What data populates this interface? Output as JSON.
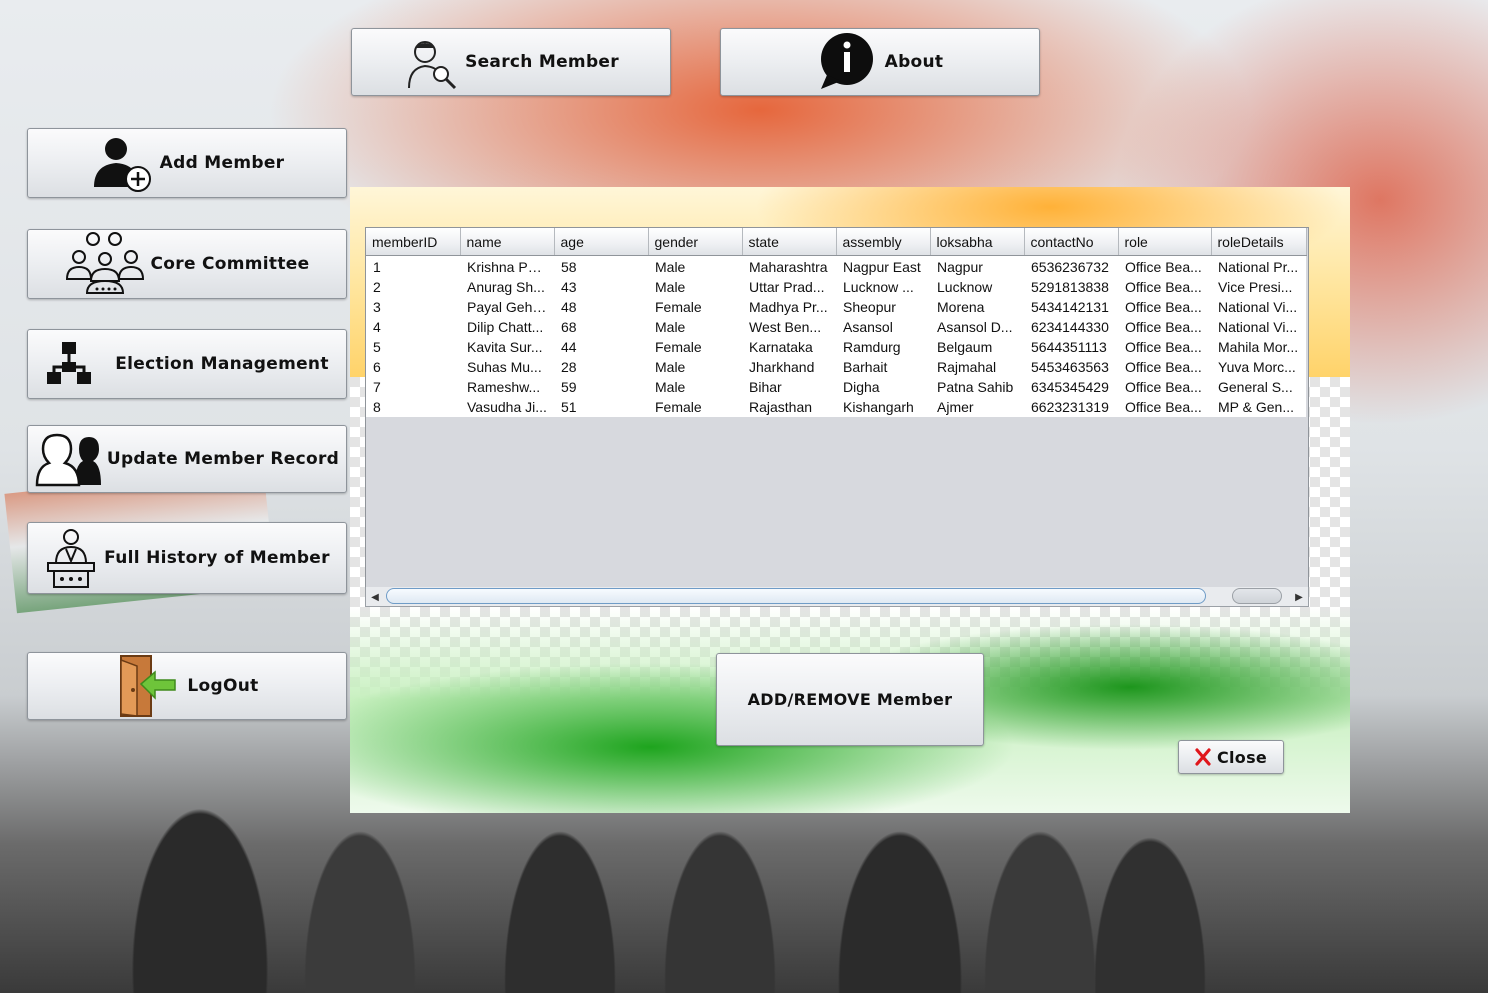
{
  "top_buttons": {
    "search": {
      "label": "Search Member",
      "icon": "search-member-icon"
    },
    "about": {
      "label": "About",
      "icon": "info-icon"
    }
  },
  "sidebar": {
    "items": [
      {
        "label": "Add Member",
        "icon": "add-member-icon"
      },
      {
        "label": "Core Committee",
        "icon": "committee-icon"
      },
      {
        "label": "Election Management",
        "icon": "hierarchy-icon"
      },
      {
        "label": "Update Member Record",
        "icon": "users-icon"
      },
      {
        "label": "Full History of Member",
        "icon": "speaker-podium-icon"
      },
      {
        "label": "LogOut",
        "icon": "logout-door-icon"
      }
    ]
  },
  "table": {
    "columns": [
      "memberID",
      "name",
      "age",
      "gender",
      "state",
      "assembly",
      "loksabha",
      "contactNo",
      "role",
      "roleDetails"
    ],
    "rows": [
      [
        "1",
        "Krishna Pa...",
        "58",
        "Male",
        "Maharashtra",
        "Nagpur East",
        "Nagpur",
        "6536236732",
        "Office Bea...",
        "National Pr..."
      ],
      [
        "2",
        "Anurag Sh...",
        "43",
        "Male",
        "Uttar Prad...",
        "Lucknow ...",
        "Lucknow",
        "5291813838",
        "Office Bea...",
        "Vice Presi..."
      ],
      [
        "3",
        "Payal Gehl...",
        "48",
        "Female",
        "Madhya Pr...",
        "Sheopur",
        "Morena",
        "5434142131",
        "Office Bea...",
        "National Vi..."
      ],
      [
        "4",
        "Dilip Chatt...",
        "68",
        "Male",
        "West Ben...",
        "Asansol",
        "Asansol D...",
        "6234144330",
        "Office Bea...",
        "National Vi..."
      ],
      [
        "5",
        "Kavita Sur...",
        "44",
        "Female",
        "Karnataka",
        "Ramdurg",
        "Belgaum",
        "5644351113",
        "Office Bea...",
        "Mahila Mor..."
      ],
      [
        "6",
        "Suhas Mu...",
        "28",
        "Male",
        "Jharkhand",
        "Barhait",
        "Rajmahal",
        "5453463563",
        "Office Bea...",
        "Yuva Morc..."
      ],
      [
        "7",
        "Rameshw...",
        "59",
        "Male",
        "Bihar",
        "Digha",
        "Patna Sahib",
        "6345345429",
        "Office Bea...",
        "General S..."
      ],
      [
        "8",
        "Vasudha Ji...",
        "51",
        "Female",
        "Rajasthan",
        "Kishangarh",
        "Ajmer",
        "6623231319",
        "Office Bea...",
        "MP & Gen..."
      ]
    ]
  },
  "actions": {
    "add_remove": "ADD/REMOVE Member",
    "close": "Close"
  },
  "colors": {
    "close_x": "#e0161b",
    "scroll_thumb_border": "#6f9cc7"
  }
}
